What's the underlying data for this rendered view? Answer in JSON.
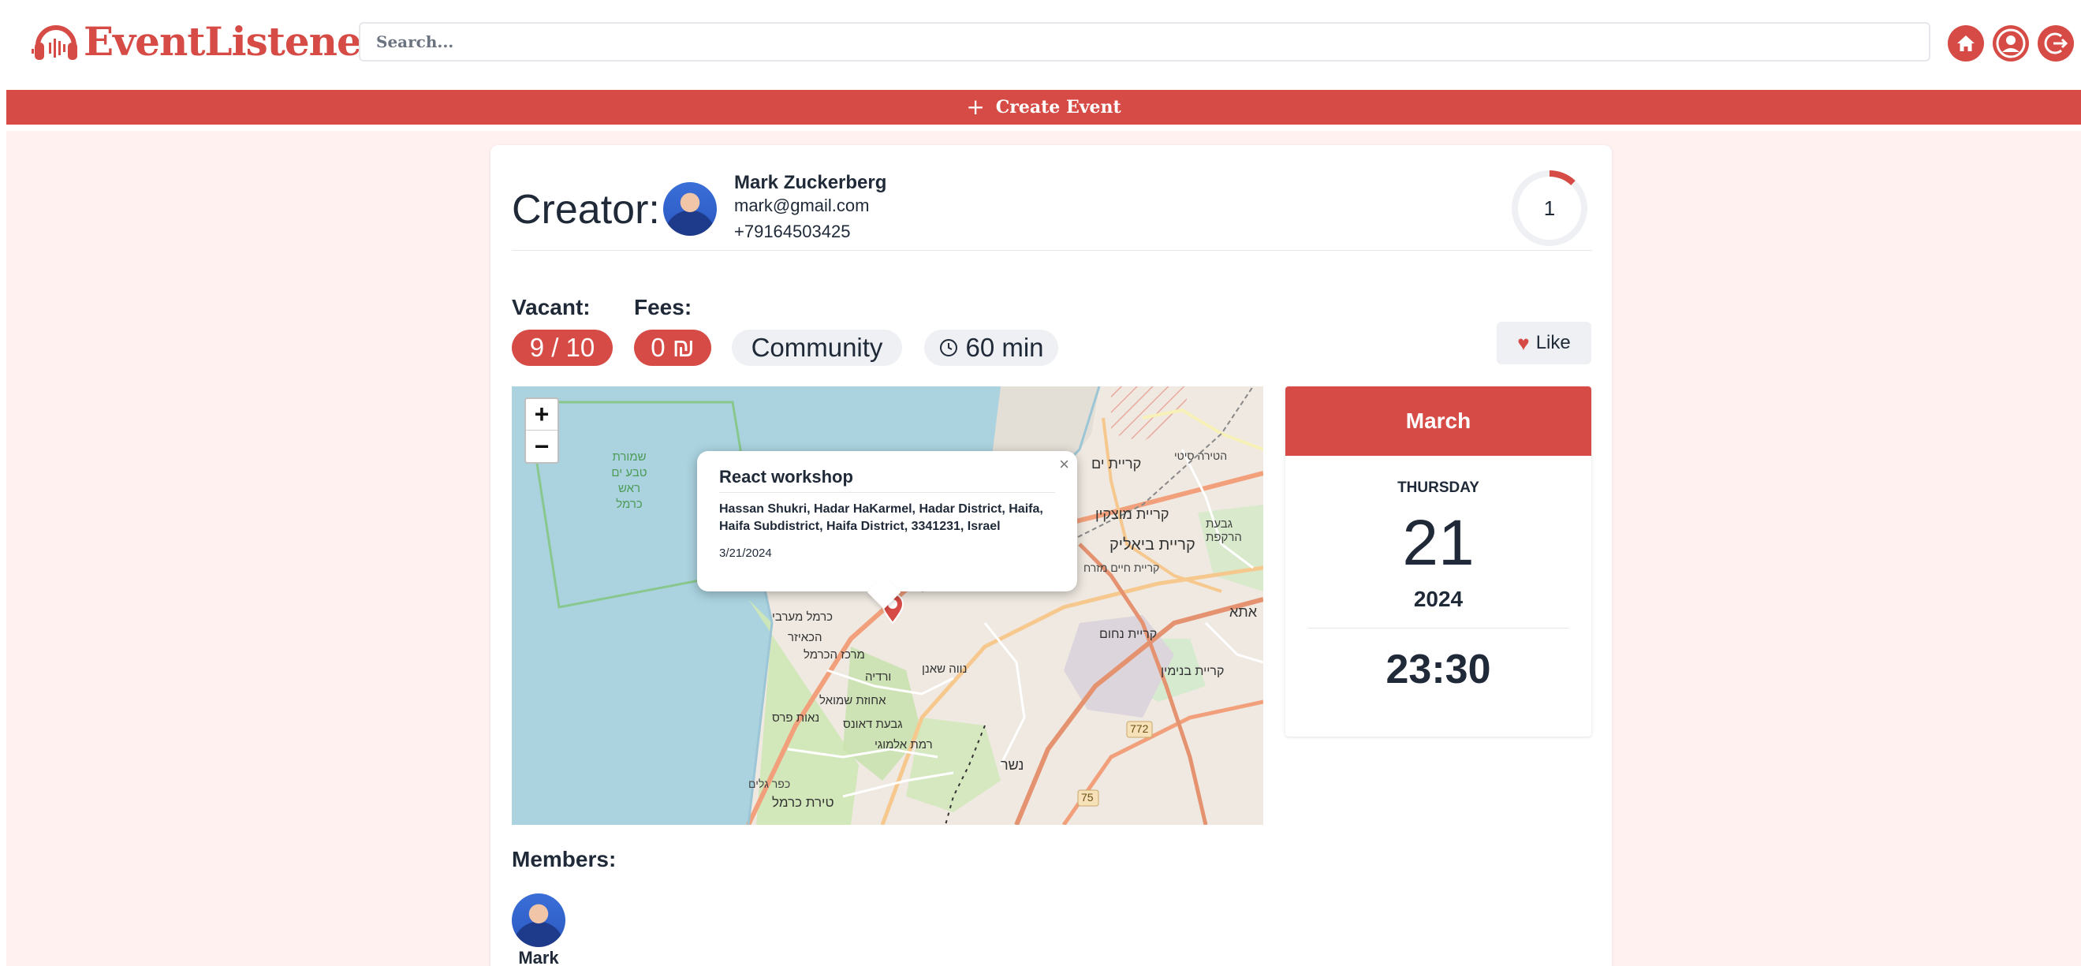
{
  "app": {
    "brand": "EventListener"
  },
  "header": {
    "search_placeholder": "Search...",
    "buttons": [
      "home-icon",
      "user-icon",
      "logout-icon"
    ]
  },
  "create_bar": {
    "icon": "+",
    "label": "Create Event"
  },
  "colors": {
    "accent": "#d64b45",
    "bg_tint": "#fff1f0"
  },
  "creator": {
    "label": "Creator:",
    "name": "Mark Zuckerberg",
    "email": "mark@gmail.com",
    "phone": "+79164503425",
    "participants_count": "1"
  },
  "stats": {
    "vacant_label": "Vacant:",
    "vacant_value": "9 / 10",
    "fees_label": "Fees:",
    "fees_value": "0 ₪",
    "category": "Community",
    "duration": "60 min",
    "like_label": "Like"
  },
  "map": {
    "zoom_in": "+",
    "zoom_out": "−",
    "popup": {
      "title": "React workshop",
      "address": "Hassan Shukri, Hadar HaKarmel, Hadar District, Haifa, Haifa Subdistrict, Haifa District, 3341231, Israel",
      "date": "3/21/2024",
      "close": "×"
    },
    "labels": {
      "reserve": [
        "שמורת",
        "טבע ים",
        "ראש כרמל"
      ],
      "kiryat_yam": "קריית ים",
      "kiryat_motzkin": "קריית מוצקין",
      "kiryat_bialik": "קריית ביאליק",
      "kiryat_haim": "קריית חיים מזרח",
      "givat_harakefet": "גבעת הרקפת",
      "kiryat_ata": "אתא",
      "kiryat_nachum": "קריית נחום",
      "kiryat_binyamin": "קריית בנימין",
      "hatira": "הטירה סיטי",
      "carmel_maaravi": "כרמל מערבי",
      "hakaisar": "הכאיזר",
      "merkaz_hacarmel": "מרכז הכרמל",
      "vardia": "ורדיה",
      "neve_shaanan": "נווה שאנן",
      "ahuzat_shmuel": "אחוזת שמואל",
      "neot_peres": "נאות פרס",
      "givat_daunas": "גבעת דאונס",
      "ramat_almogi": "רמת אלמוגי",
      "tirat_carmel": "טירת כרמל",
      "nesher": "נשר",
      "kfar_galim": "כפר גלים",
      "road_772": "772",
      "road_75": "75"
    }
  },
  "date_panel": {
    "month": "March",
    "weekday": "THURSDAY",
    "day": "21",
    "year": "2024",
    "time": "23:30"
  },
  "members": {
    "label": "Members:",
    "items": [
      {
        "name": "Mark"
      }
    ]
  }
}
